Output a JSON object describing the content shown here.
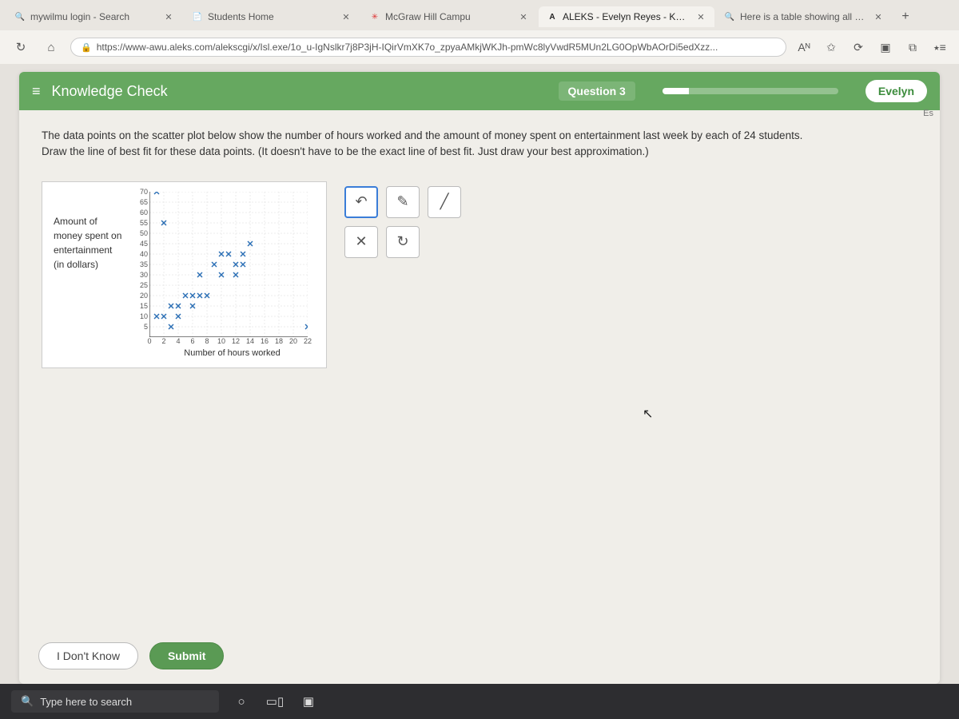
{
  "tabs": [
    {
      "title": "mywilmu login - Search",
      "favicon": "🔍"
    },
    {
      "title": "Students Home",
      "favicon": "📄"
    },
    {
      "title": "McGraw Hill Campu",
      "favicon": "✳"
    },
    {
      "title": "ALEKS - Evelyn Reyes - Knowled",
      "favicon": "A",
      "active": true
    },
    {
      "title": "Here is a table showing all cards",
      "favicon": "🔍"
    }
  ],
  "url": "https://www-awu.aleks.com/alekscgi/x/Isl.exe/1o_u-IgNslkr7j8P3jH-IQirVmXK7o_zpyaAMkjWKJh-pmWc8lyVwdR5MUn2LG0OpWbAOrDi5edXzz...",
  "header": {
    "title": "Knowledge Check",
    "question": "Question 3",
    "user": "Evelyn",
    "lang": "Es"
  },
  "prompt": {
    "line1": "The data points on the scatter plot below show the number of hours worked and the amount of money spent on entertainment last week by each of 24 students.",
    "line2": "Draw the line of best fit for these data points. (It doesn't have to be the exact line of best fit. Just draw your best approximation.)"
  },
  "chart_data": {
    "type": "scatter",
    "title": "",
    "xlabel": "Number of hours worked",
    "ylabel_lines": [
      "Amount of",
      "money spent on",
      "entertainment",
      "(in dollars)"
    ],
    "xlim": [
      0,
      22
    ],
    "ylim": [
      0,
      70
    ],
    "x_ticks": [
      0,
      2,
      4,
      6,
      8,
      10,
      12,
      14,
      16,
      18,
      20,
      22
    ],
    "y_ticks": [
      5,
      10,
      15,
      20,
      25,
      30,
      35,
      40,
      45,
      50,
      55,
      60,
      65,
      70
    ],
    "points": [
      {
        "x": 1,
        "y": 70
      },
      {
        "x": 1,
        "y": 10
      },
      {
        "x": 2,
        "y": 55
      },
      {
        "x": 2,
        "y": 10
      },
      {
        "x": 3,
        "y": 15
      },
      {
        "x": 3,
        "y": 5
      },
      {
        "x": 4,
        "y": 15
      },
      {
        "x": 4,
        "y": 10
      },
      {
        "x": 5,
        "y": 20
      },
      {
        "x": 6,
        "y": 20
      },
      {
        "x": 6,
        "y": 15
      },
      {
        "x": 7,
        "y": 20
      },
      {
        "x": 7,
        "y": 30
      },
      {
        "x": 8,
        "y": 20
      },
      {
        "x": 9,
        "y": 35
      },
      {
        "x": 10,
        "y": 40
      },
      {
        "x": 10,
        "y": 30
      },
      {
        "x": 11,
        "y": 40
      },
      {
        "x": 12,
        "y": 35
      },
      {
        "x": 12,
        "y": 30
      },
      {
        "x": 13,
        "y": 40
      },
      {
        "x": 13,
        "y": 35
      },
      {
        "x": 14,
        "y": 45
      },
      {
        "x": 22,
        "y": 5
      }
    ]
  },
  "tools": {
    "undo": "↶",
    "pen": "✎",
    "line": "╱",
    "delete": "✕",
    "reset": "↻"
  },
  "buttons": {
    "idk": "I Don't Know",
    "submit": "Submit"
  },
  "taskbar": {
    "search": "Type here to search"
  }
}
